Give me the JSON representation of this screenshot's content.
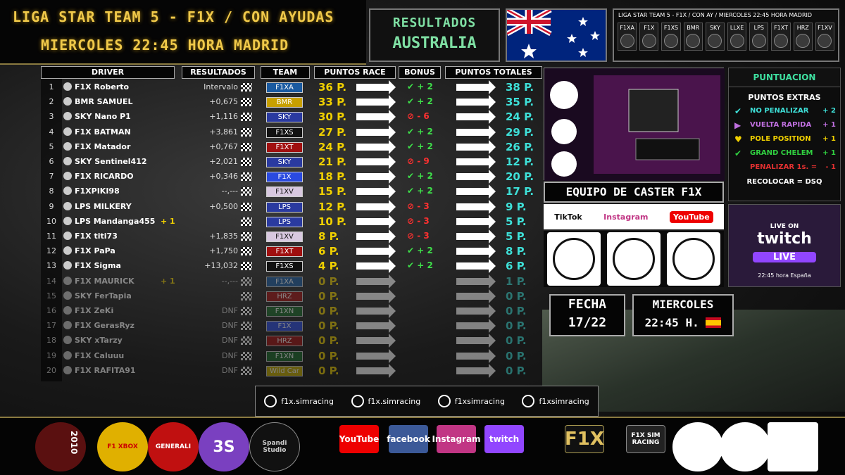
{
  "header": {
    "line1": "LIGA STAR TEAM 5 - F1X / CON AYUDAS",
    "line2": "MIERCOLES 22:45 HORA MADRID",
    "results_label": "RESULTADOS",
    "circuit": "AUSTRALIA",
    "league_strip": "LIGA STAR TEAM 5 - F1X  /  CON AY  /  MIERCOLES 22:45 HORA MADRID",
    "team_logos": [
      "F1XA",
      "F1X",
      "F1XS",
      "BMR",
      "SKY",
      "LLXE",
      "LPS",
      "F1XT",
      "HRZ",
      "F1XV"
    ]
  },
  "columns": {
    "driver": "DRIVER",
    "results": "RESULTADOS",
    "team": "TEAM",
    "race_points": "PUNTOS RACE",
    "bonus": "BONUS",
    "total_points": "PUNTOS TOTALES"
  },
  "rows": [
    {
      "pos": "1",
      "driver": "F1X Roberto",
      "result": "Intervalo",
      "team": "F1XA",
      "team_color": "#1a5aa0",
      "race": "36 P.",
      "bonus": "+ 2",
      "bonus_type": "ok",
      "total": "38 P."
    },
    {
      "pos": "2",
      "driver": "BMR SAMUEL",
      "result": "+0,675",
      "team": "BMR",
      "team_color": "#c8a000",
      "race": "33 P.",
      "bonus": "+ 2",
      "bonus_type": "ok",
      "total": "35 P."
    },
    {
      "pos": "3",
      "driver": "SKY Nano P1",
      "result": "+1,116",
      "team": "SKY",
      "team_color": "#2a3aa0",
      "race": "30 P.",
      "bonus": "- 6",
      "bonus_type": "pen",
      "total": "24 P."
    },
    {
      "pos": "4",
      "driver": "F1X BATMAN",
      "result": "+3,861",
      "team": "F1XS",
      "team_color": "#111111",
      "race": "27 P.",
      "bonus": "+ 2",
      "bonus_type": "ok",
      "total": "29 P."
    },
    {
      "pos": "5",
      "driver": "F1X Matador",
      "result": "+0,767",
      "team": "F1XT",
      "team_color": "#a01010",
      "race": "24 P.",
      "bonus": "+ 2",
      "bonus_type": "ok",
      "total": "26 P."
    },
    {
      "pos": "6",
      "driver": "SKY Sentinel412",
      "result": "+2,021",
      "team": "SKY",
      "team_color": "#2a3aa0",
      "race": "21 P.",
      "bonus": "- 9",
      "bonus_type": "pen",
      "total": "12 P."
    },
    {
      "pos": "7",
      "driver": "F1X RICARDO",
      "result": "+0,346",
      "team": "F1X",
      "team_color": "#2a4ae0",
      "race": "18 P.",
      "bonus": "+ 2",
      "bonus_type": "ok",
      "total": "20 P."
    },
    {
      "pos": "8",
      "driver": "F1XPIKI98",
      "result": "--,---",
      "team": "F1XV",
      "team_color": "#d8c8e0",
      "race": "15 P.",
      "bonus": "+ 2",
      "bonus_type": "ok",
      "total": "17 P."
    },
    {
      "pos": "9",
      "driver": "LPS MILKERY",
      "result": "+0,500",
      "team": "LPS",
      "team_color": "#2a3aa0",
      "race": "12 P.",
      "bonus": "- 3",
      "bonus_type": "pen",
      "total": "9 P."
    },
    {
      "pos": "10",
      "driver": "LPS Mandanga455",
      "result": "",
      "extra": "+ 1",
      "team": "LPS",
      "team_color": "#2a3aa0",
      "race": "10 P.",
      "bonus": "- 3",
      "bonus_type": "pen",
      "total": "5 P."
    },
    {
      "pos": "11",
      "driver": "F1X titi73",
      "result": "+1,835",
      "team": "F1XV",
      "team_color": "#d8c8e0",
      "race": "8 P.",
      "bonus": "- 3",
      "bonus_type": "pen",
      "total": "5 P."
    },
    {
      "pos": "12",
      "driver": "F1X PaPa",
      "result": "+1,750",
      "team": "F1XT",
      "team_color": "#a01010",
      "race": "6 P.",
      "bonus": "+ 2",
      "bonus_type": "ok",
      "total": "8 P."
    },
    {
      "pos": "13",
      "driver": "F1X Sigma",
      "result": "+13,032",
      "team": "F1XS",
      "team_color": "#111111",
      "race": "4 P.",
      "bonus": "+ 2",
      "bonus_type": "ok",
      "total": "6 P."
    },
    {
      "pos": "14",
      "driver": "F1X MAURICK",
      "result": "--,---",
      "extra": "+ 1",
      "team": "F1XA",
      "team_color": "#1a5aa0",
      "race": "0 P.",
      "bonus": "",
      "bonus_type": "",
      "total": "1 P."
    },
    {
      "pos": "15",
      "driver": "SKY FerTapia",
      "result": "",
      "team": "HRZ",
      "team_color": "#a01010",
      "race": "0 P.",
      "bonus": "",
      "bonus_type": "",
      "total": "0 P."
    },
    {
      "pos": "16",
      "driver": "F1X ZeKi",
      "result": "DNF",
      "team": "F1XN",
      "team_color": "#1a6a2a",
      "race": "0 P.",
      "bonus": "",
      "bonus_type": "",
      "total": "0 P."
    },
    {
      "pos": "17",
      "driver": "F1X GerasRyz",
      "result": "DNF",
      "team": "F1X",
      "team_color": "#2a4ae0",
      "race": "0 P.",
      "bonus": "",
      "bonus_type": "",
      "total": "0 P."
    },
    {
      "pos": "18",
      "driver": "SKY xTarzy",
      "result": "DNF",
      "team": "HRZ",
      "team_color": "#a01010",
      "race": "0 P.",
      "bonus": "",
      "bonus_type": "",
      "total": "0 P."
    },
    {
      "pos": "19",
      "driver": "F1X Caluuu",
      "result": "DNF",
      "team": "F1XN",
      "team_color": "#1a6a2a",
      "race": "0 P.",
      "bonus": "",
      "bonus_type": "",
      "total": "0 P."
    },
    {
      "pos": "20",
      "driver": "F1X RAFITA91",
      "result": "DNF",
      "team": "Wild Car",
      "team_color": "#c8b000",
      "race": "0 P.",
      "bonus": "",
      "bonus_type": "",
      "total": "0 P."
    }
  ],
  "caster": {
    "title": "EQUIPO DE CASTER F1X",
    "tiktok": "TikTok",
    "instagram": "Instagram",
    "youtube": "YouTube"
  },
  "puntuacion": {
    "title": "PUNTUACION",
    "extras_title": "PUNTOS EXTRAS",
    "items": [
      {
        "label": "NO PENALIZAR",
        "value": "+ 2",
        "color": "#3ee0d8"
      },
      {
        "label": "VUELTA RAPIDA",
        "value": "+ 1",
        "color": "#c070e0"
      },
      {
        "label": "POLE POSITION",
        "value": "+ 1",
        "color": "#f0d000"
      },
      {
        "label": "GRAND CHELEM",
        "value": "+ 1",
        "color": "#30d040"
      },
      {
        "label": "PENALIZAR  1s. =",
        "value": "- 1",
        "color": "#e03030"
      }
    ],
    "recolocar": "RECOLOCAR  =  DSQ"
  },
  "twitch": {
    "live_on": "LIVE ON",
    "brand": "twitch",
    "live": "LIVE",
    "time": "22:45 hora España"
  },
  "fecha": {
    "label": "FECHA",
    "value": "17/22"
  },
  "dia": {
    "label": "MIERCOLES",
    "time": "22:45 H."
  },
  "social_bottom": [
    "f1x.simracing",
    "f1x.simracing",
    "f1xsimracing",
    "f1xsimracing"
  ],
  "footer": {
    "year": "2010",
    "sponsors": [
      "F1 XBOX",
      "GENERALI",
      "3S",
      "Spandi Studio",
      "YouTube",
      "facebook",
      "Instagram",
      "twitch",
      "F1X",
      "F1X SIM RACING"
    ]
  }
}
